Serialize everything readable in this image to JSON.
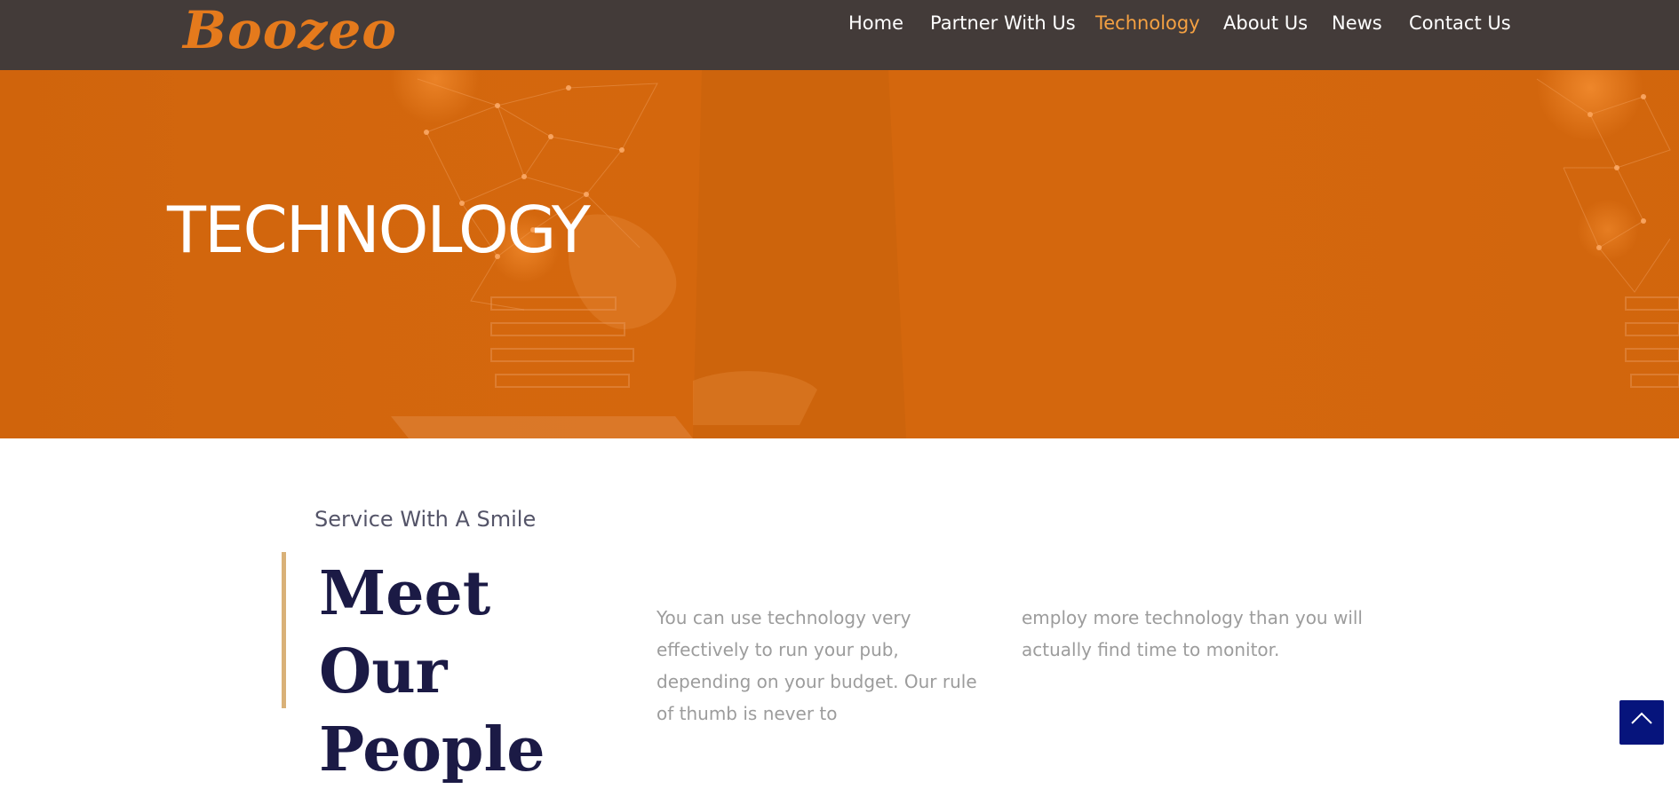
{
  "header": {
    "logo_text": "Boozeo",
    "nav": [
      {
        "label": "Home",
        "active": false
      },
      {
        "label": "Partner With Us",
        "active": false
      },
      {
        "label": "Technology",
        "active": true
      },
      {
        "label": "About Us",
        "active": false
      },
      {
        "label": "News",
        "active": false
      },
      {
        "label": "Contact Us",
        "active": false
      }
    ]
  },
  "hero": {
    "title": "TECHNOLOGY"
  },
  "section": {
    "subtitle": "Service With A Smile",
    "heading_line1": "Meet Our",
    "heading_line2": "People",
    "paragraph_col1": "You can use technology very effectively to run your pub, depending on your budget. Our rule of thumb is never to",
    "paragraph_col2": "employ more technology than you will actually find time to monitor."
  },
  "back_to_top": {
    "icon": "chevron-up-icon"
  },
  "colors": {
    "header_bg": "#433b39",
    "logo": "#e57a1c",
    "nav_active": "#f5a142",
    "hero_bg": "#d4670d",
    "accent_bar": "#d9b178",
    "heading": "#1b1a45",
    "back_to_top_bg": "#06147c"
  }
}
